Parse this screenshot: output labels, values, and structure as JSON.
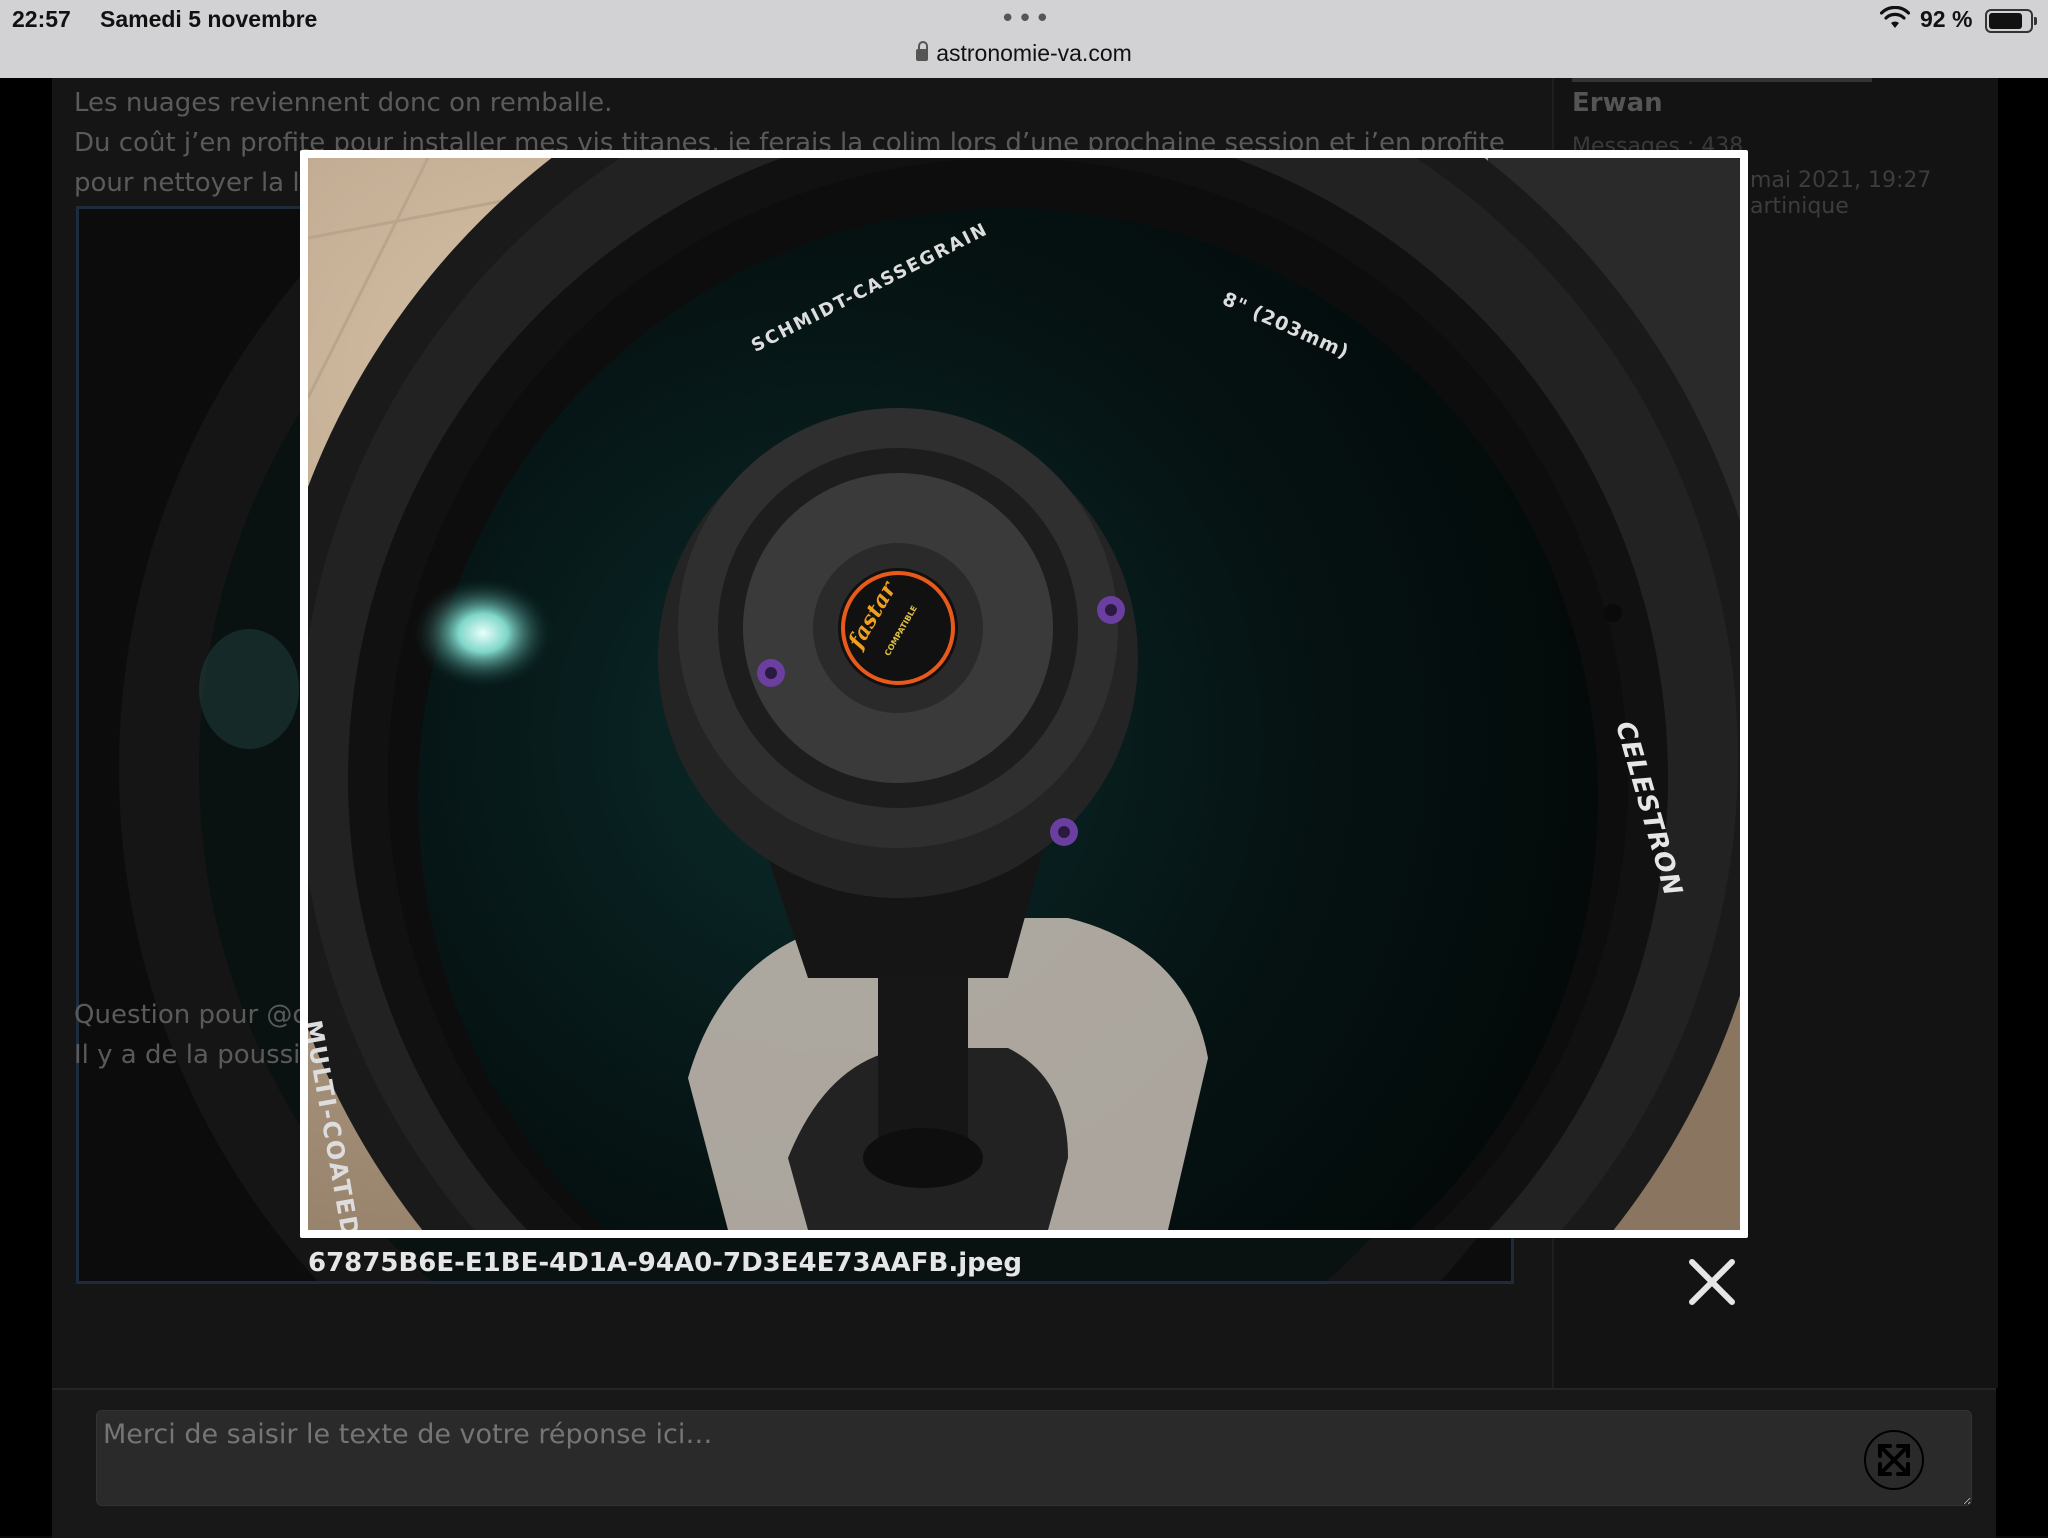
{
  "status_bar": {
    "time": "22:57",
    "date": "Samedi 5 novembre",
    "battery": "92 %",
    "battery_level": 0.92,
    "url": "astronomie-va.com"
  },
  "post": {
    "line1": "Les nuages reviennent donc on remballe.",
    "line2": "Du coût j’en profite pour installer mes vis titanes, je ferais la colim lors d’une prochaine session et j’en profite",
    "line3": "pour nettoyer la la",
    "question_line1": "Question pour @clouzot",
    "question_line2": "Il y a de la poussière sur la lame côté interne du tube cela doit rentrer quand je retire le réducteur non."
  },
  "author": {
    "name": "Erwan",
    "messages_label": "Messages : 438",
    "date": "mai 2021, 19:27",
    "location": "artinique"
  },
  "reply": {
    "placeholder": "Merci de saisir le texte de votre réponse ici…"
  },
  "lightbox": {
    "caption": "67875B6E-E1BE-4D1A-94A0-7D3E4E73AAFB.jpeg",
    "photo_text": {
      "schmidt": "SCHMIDT-CASSEGRAIN",
      "size": "8\" (203mm)",
      "brand": "CELESTRON",
      "coating": "MULTI-COATED",
      "logo": "fastar",
      "logo_sub": "COMPATIBLE"
    }
  },
  "icons": {
    "lock": "lock-icon",
    "wifi": "wifi-icon",
    "battery": "battery-icon",
    "close": "close-icon",
    "expand": "expand-icon"
  }
}
